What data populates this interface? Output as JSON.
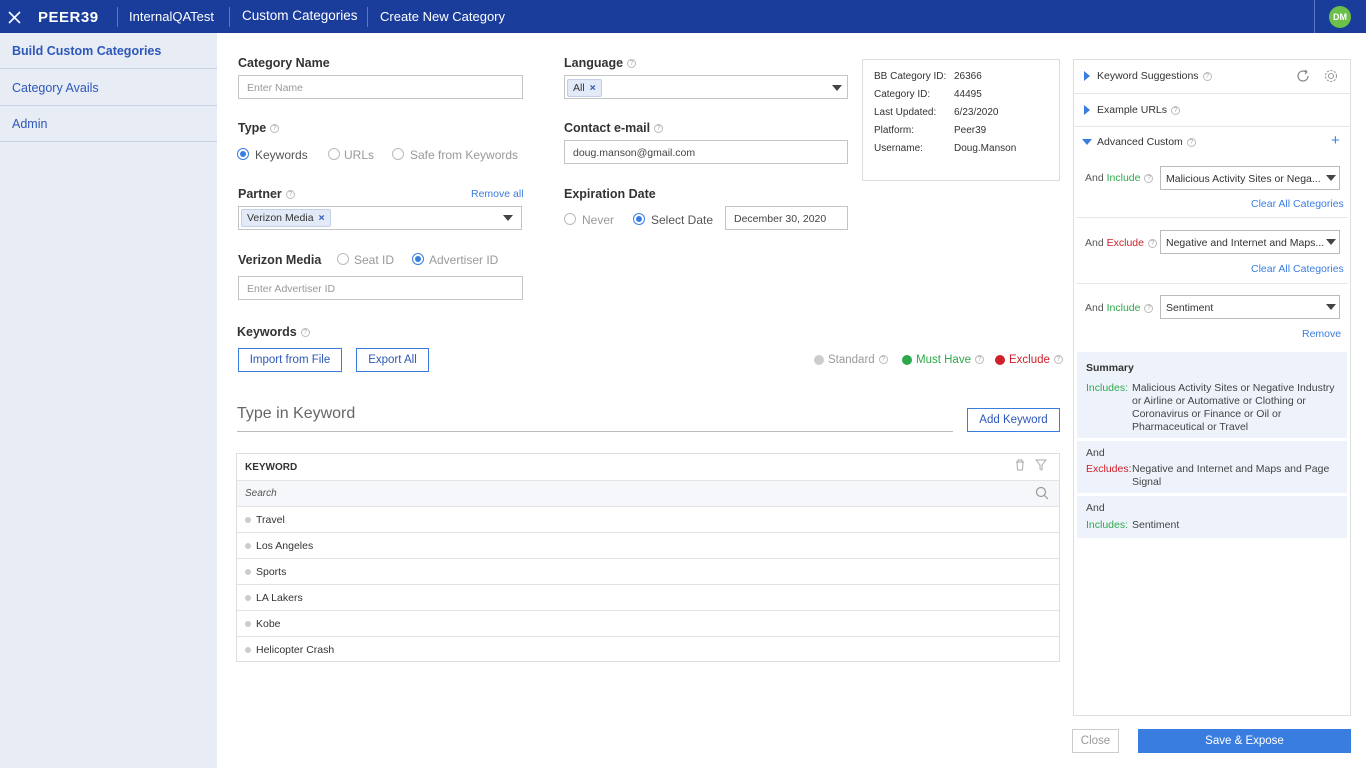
{
  "topbar": {
    "logo": "PEER39",
    "breadcrumb": [
      "InternalQATest",
      "Custom Categories",
      "Create New Category"
    ],
    "avatar": "DM"
  },
  "sidebar": {
    "items": [
      "Build Custom Categories",
      "Category Avails",
      "Admin"
    ]
  },
  "form": {
    "category_name_label": "Category Name",
    "category_name_placeholder": "Enter Name",
    "type_label": "Type",
    "type_options": [
      "Keywords",
      "URLs",
      "Safe from Keywords"
    ],
    "partner_label": "Partner",
    "remove_all": "Remove all",
    "partner_chip": "Verizon Media",
    "verizon_label": "Verizon Media",
    "id_options": [
      "Seat ID",
      "Advertiser ID"
    ],
    "advertiser_placeholder": "Enter Advertiser ID",
    "language_label": "Language",
    "language_chip": "All",
    "contact_label": "Contact e-mail",
    "contact_value": "doug.manson@gmail.com",
    "expiration_label": "Expiration Date",
    "expiration_options": [
      "Never",
      "Select Date"
    ],
    "expiration_date": "December 30, 2020"
  },
  "info": {
    "rows": [
      {
        "k": "BB Category ID:",
        "v": "26366"
      },
      {
        "k": "Category ID:",
        "v": "44495"
      },
      {
        "k": "Last Updated:",
        "v": "6/23/2020"
      },
      {
        "k": "Platform:",
        "v": "Peer39"
      },
      {
        "k": "Username:",
        "v": "Doug.Manson"
      }
    ]
  },
  "keywords": {
    "label": "Keywords",
    "import_btn": "Import from File",
    "export_btn": "Export All",
    "legend": [
      "Standard",
      "Must Have",
      "Exclude"
    ],
    "input_placeholder": "Type in Keyword",
    "add_btn": "Add Keyword",
    "column_header": "KEYWORD",
    "search_placeholder": "Search",
    "rows": [
      "Travel",
      "Los Angeles",
      "Sports",
      "LA Lakers",
      "Kobe",
      "Helicopter Crash"
    ]
  },
  "right_panel": {
    "keyword_suggestions": "Keyword Suggestions",
    "example_urls": "Example URLs",
    "advanced_custom": "Advanced Custom",
    "and": "And",
    "include": "Include",
    "exclude": "Exclude",
    "cond1_value": "Malicious Activity Sites or Nega...",
    "cond2_value": "Negative and Internet and Maps...",
    "cond3_value": "Sentiment",
    "clear_all": "Clear All Categories",
    "remove": "Remove",
    "summary_title": "Summary",
    "includes_label": "Includes:",
    "excludes_label": "Excludes:",
    "summary_inc1": "Malicious Activity Sites or Negative Industry or Airline or Automative or Clothing or Coronavirus or Finance or Oil or Pharmaceutical or Travel",
    "summary_exc": "Negative and Internet and Maps and Page Signal",
    "summary_inc2": "Sentiment"
  },
  "footer": {
    "close_btn": "Close",
    "save_btn": "Save & Expose"
  },
  "colors": {
    "topbar": "#1a3d9c",
    "accent": "#3a7de0",
    "include": "#2ea84a",
    "exclude": "#d0202a",
    "standard": "#cccccc"
  }
}
